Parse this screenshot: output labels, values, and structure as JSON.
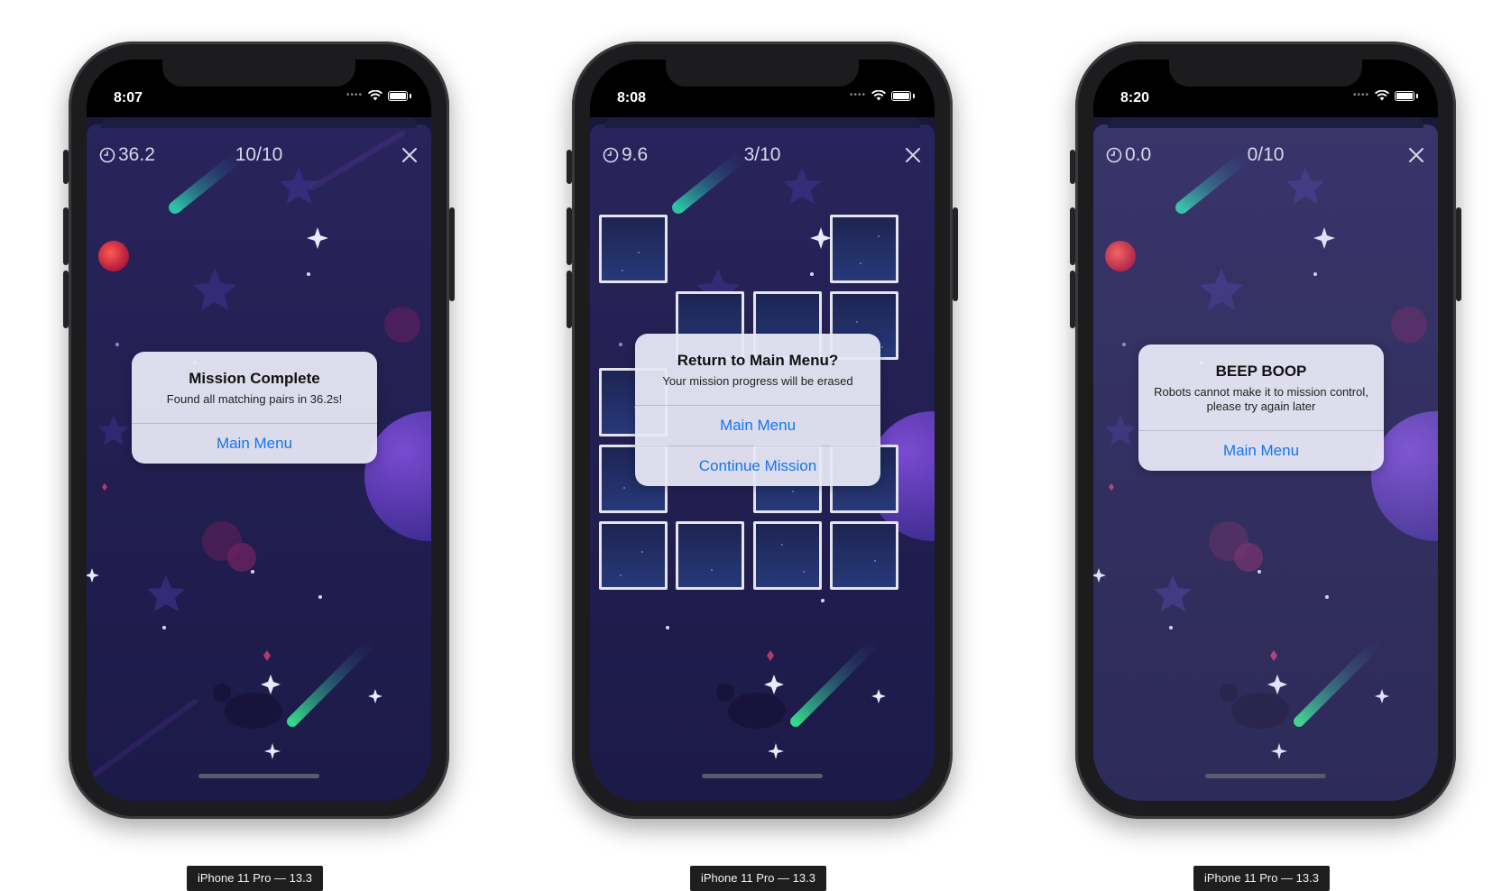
{
  "devices": [
    {
      "status_time": "8:07",
      "timer": "36.2",
      "score": "10/10",
      "dimmed": false,
      "alert": {
        "title": "Mission Complete",
        "message": "Found all matching pairs in 36.2s!",
        "actions": [
          "Main Menu"
        ]
      },
      "caption": "iPhone 11 Pro — 13.3"
    },
    {
      "status_time": "8:08",
      "timer": "9.6",
      "score": "3/10",
      "dimmed": false,
      "alert": {
        "title": "Return to Main Menu?",
        "message": "Your mission progress will be erased",
        "actions": [
          "Main Menu",
          "Continue Mission"
        ]
      },
      "caption": "iPhone 11 Pro — 13.3"
    },
    {
      "status_time": "8:20",
      "timer": "0.0",
      "score": "0/10",
      "dimmed": true,
      "alert": {
        "title": "BEEP BOOP",
        "message": "Robots cannot make it to mission control, please try again later",
        "actions": [
          "Main Menu"
        ]
      },
      "caption": "iPhone 11 Pro — 13.3"
    }
  ],
  "icons": {
    "timer": "clock-icon",
    "close": "close-icon",
    "wifi": "wifi-icon",
    "battery": "battery-icon",
    "signal": "signal-icon"
  },
  "colors": {
    "alert_action": "#1476f0",
    "background": "#231f52",
    "card_border": "#e4e4ec"
  }
}
